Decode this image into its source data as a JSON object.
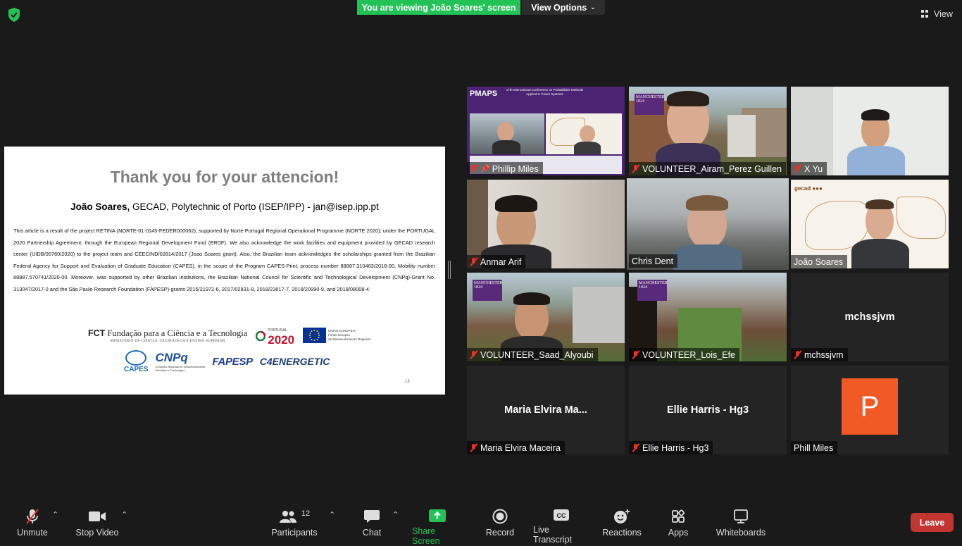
{
  "top": {
    "banner": "You are viewing João Soares' screen",
    "view_options": "View Options",
    "view": "View"
  },
  "slide": {
    "title": "Thank you for your attencion!",
    "author_name": "João Soares,",
    "author_rest": " GECAD, Polytechnic of Porto (ISEP/IPP) - jan@isep.ipp.pt",
    "body": "This article is a result of the project RETINA (NORTE-01-0145-FEDER000062), supported by Norte Portugal Regional Operational Programme (NORTE 2020), under the PORTUGAL 2020 Partnership Agreement, through the European Regional Development Fund (ERDF). We also acknowledge the work facilities and equipment provided by GECAD research center (UIDB/00760/2020) to the project team and CEECIND/02814/2017 (Joao Soares grant). Also, the Brazilian team acknowledges the scholarships granted from the Brazilian Federal Agency for Support and Evaluation of Graduate Education (CAPES), in the scope of the Program CAPES-Print, process number 88887.310463/2018-00, Mobility number 88887.570741/2020-00. Moreover, was supported by other Brazilian institutions, the Brazilian National Council for Scientific and Technological Development (CNPq)-Grant No. 313047/2017-0 and the São Paulo Research Foundation (FAPESP)-grants 2015/21972-6, 2017/02831-8, 2018/23617-7, 2018/20990-9, and 2018/08008-4.",
    "fct_abbr": "FCT",
    "fct_name": " Fundação para a Ciência e a Tecnologia",
    "fct_sub": "MINISTÉRIO DA CIÊNCIA, TECNOLOGIA E ENSINO SUPERIOR",
    "portugal": "PORTUGAL",
    "pt2020": "2020",
    "eu_text_1": "UNIÃO EUROPEIA",
    "eu_text_2": "Fundo Europeu",
    "eu_text_3": "de Desenvolvimento Regional",
    "capes": "CAPES",
    "cnpq": "CNPq",
    "cnpq_sub_1": "Conselho Nacional de Desenvolvimento",
    "cnpq_sub_2": "Científico e Tecnológico",
    "fapesp": "FAPESP",
    "c4e": "C4ENERGETIC",
    "page_number": "13"
  },
  "participants": [
    {
      "name": "Phillip Miles",
      "muted": true,
      "pinned": true
    },
    {
      "name": "VOLUNTEER_Airam_Perez Guillen",
      "muted": true
    },
    {
      "name": "X Yu",
      "muted": true
    },
    {
      "name": "Anmar Arif",
      "muted": true
    },
    {
      "name": "Chris Dent",
      "muted": false,
      "speaking": true
    },
    {
      "name": "João Soares",
      "muted": false
    },
    {
      "name": "VOLUNTEER_Saad_Alyoubi",
      "muted": true
    },
    {
      "name": "VOLUNTEER_Lois_Efe",
      "muted": true
    },
    {
      "name": "mchssjvm",
      "muted": true,
      "display": "mchssjvm"
    },
    {
      "name": "Maria Elvira Maceira",
      "muted": true,
      "display": "Maria  Elvira  Ma..."
    },
    {
      "name": "Ellie Harris - Hg3",
      "muted": true,
      "display": "Ellie Harris - Hg3"
    },
    {
      "name": "Phill Miles",
      "muted": false,
      "avatar": "P"
    }
  ],
  "tile_text": {
    "pmaps": "PMAPS",
    "pmaps_conf": "17th International Conference on Probabilistic Methods Applied to Power Systems",
    "manchester": "MANCHESTER 1824"
  },
  "toolbar": {
    "unmute": "Unmute",
    "stop_video": "Stop Video",
    "participants": "Participants",
    "participants_count": "12",
    "chat": "Chat",
    "share_screen": "Share Screen",
    "record": "Record",
    "live_transcript": "Live Transcript",
    "reactions": "Reactions",
    "apps": "Apps",
    "whiteboards": "Whiteboards",
    "leave": "Leave"
  },
  "colors": {
    "banner_green": "#23c256",
    "leave_red": "#c33531",
    "speaking_outline": "#c8e06a",
    "avatar_orange": "#f25a25"
  }
}
